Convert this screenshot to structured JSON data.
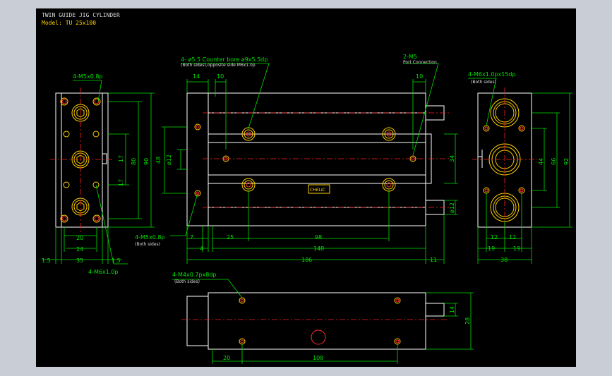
{
  "title": {
    "line1": "TWIN GUIDE JIG CYLINDER",
    "line2": "Model: TU 25x100"
  },
  "colors": {
    "background": "#000000",
    "outline": "#ffffff",
    "dimension": "#00e000",
    "centerline": "#ff2020",
    "holes": "#ffd000",
    "frame": "#c9cdd6"
  },
  "callouts": {
    "counterbore": "4- ø5.5 Counter bore ø9x5.5dp",
    "counterbore_sub": "(Both sides),opposite side M6x1.0p",
    "port": "2-M5",
    "port_sub": "Port Connection",
    "left_tap": "4-M5x0.8p",
    "right_tap": "4-M6x1.0px15dp",
    "right_tap_sub": "(Both sides)",
    "front_tap": "4-M5x0.8p",
    "front_tap_sub": "(Both sides)",
    "bottom_tap": "4-M6x1.0p",
    "lower_tap": "4-M4x0.7px8dp",
    "lower_tap_sub": "(Both sides)",
    "label": "CHELIC"
  },
  "dims": {
    "left": {
      "d17a": "17",
      "d17b": "17",
      "d80": "80",
      "d90": "90",
      "d20": "20",
      "d24": "24",
      "d35": "35",
      "d15l": "1.5",
      "d15r": "1.5"
    },
    "front": {
      "d14": "14",
      "d10a": "10",
      "d10b": "10",
      "d48": "48",
      "d12": "ø12",
      "d34": "34",
      "d12r": "ø12",
      "d7": "7",
      "d4": "4",
      "d25": "25",
      "d98": "98",
      "d148": "148",
      "d186": "186",
      "d11": "11"
    },
    "right": {
      "d44": "44",
      "d66": "66",
      "d92": "92",
      "d12a": "12",
      "d12b": "12",
      "d19a": "19",
      "d19b": "19",
      "d38": "38"
    },
    "bottom": {
      "d14": "14",
      "d28": "28",
      "d20": "20",
      "d108": "108"
    }
  }
}
